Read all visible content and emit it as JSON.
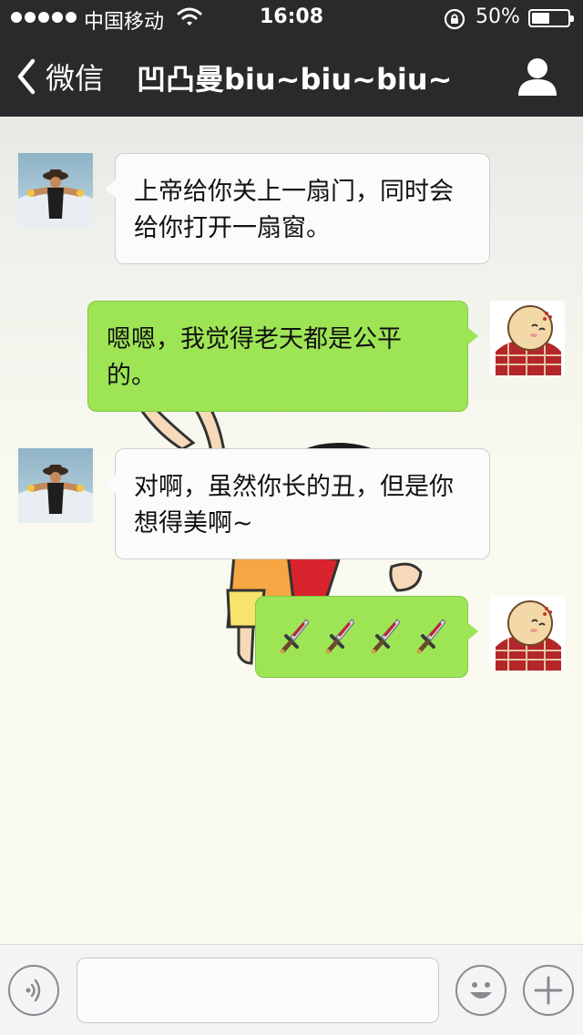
{
  "status_bar": {
    "carrier": "中国移动",
    "time": "16:08",
    "battery": "50%",
    "battery_level": 0.5
  },
  "nav": {
    "back_label": "微信",
    "title": "凹凸曼biu~biu~biu~",
    "back_icon": "chevron-left-icon",
    "profile_icon": "person-icon"
  },
  "messages": [
    {
      "side": "in",
      "text_lines": [
        "上帝给你关上一扇门，同时会",
        "给你打开一扇窗。"
      ]
    },
    {
      "side": "out",
      "text_lines": [
        "嗯嗯，我觉得老天都是公平",
        "的。"
      ]
    },
    {
      "side": "in",
      "text_lines": [
        "对啊，虽然你长的丑，但是你",
        "想得美啊~"
      ]
    },
    {
      "side": "out",
      "emoji": "dagger-icon",
      "emoji_count": 4
    }
  ],
  "input_bar": {
    "voice_icon": "voice-icon",
    "emoji_icon": "smiley-icon",
    "more_icon": "plus-icon",
    "input_value": ""
  },
  "colors": {
    "nav_bg": "#2a2a2d",
    "incoming_bubble": "#fbfbfb",
    "outgoing_bubble": "#9ee556"
  }
}
